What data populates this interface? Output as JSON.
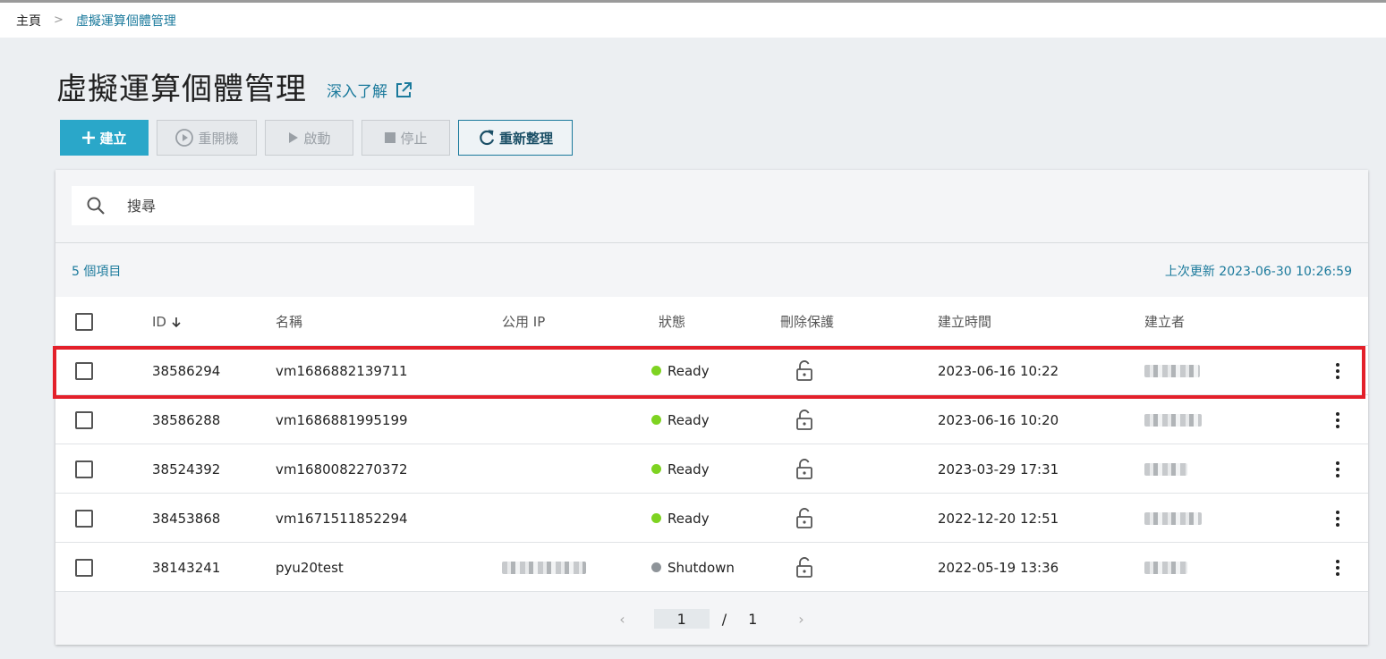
{
  "breadcrumb": {
    "home": "主頁",
    "separator": ">",
    "current": "虛擬運算個體管理"
  },
  "page": {
    "title": "虛擬運算個體管理",
    "learn_more": "深入了解"
  },
  "toolbar": {
    "create": "建立",
    "restart": "重開機",
    "start": "啟動",
    "stop": "停止",
    "refresh": "重新整理"
  },
  "search": {
    "placeholder": "搜尋"
  },
  "summary": {
    "count": "5 個項目",
    "last_updated": "上次更新 2023-06-30 10:26:59"
  },
  "table": {
    "headers": {
      "id": "ID",
      "name": "名稱",
      "public_ip": "公用 IP",
      "status": "狀態",
      "delete_protection": "刪除保護",
      "created_at": "建立時間",
      "creator": "建立者"
    },
    "rows": [
      {
        "id": "38586294",
        "name": "vm1686882139711",
        "status": "Ready",
        "created_at": "2023-06-16 10:22"
      },
      {
        "id": "38586288",
        "name": "vm1686881995199",
        "status": "Ready",
        "created_at": "2023-06-16 10:20"
      },
      {
        "id": "38524392",
        "name": "vm1680082270372",
        "status": "Ready",
        "created_at": "2023-03-29 17:31"
      },
      {
        "id": "38453868",
        "name": "vm1671511852294",
        "status": "Ready",
        "created_at": "2022-12-20 12:51"
      },
      {
        "id": "38143241",
        "name": "pyu20test",
        "status": "Shutdown",
        "created_at": "2022-05-19 13:36"
      }
    ]
  },
  "pagination": {
    "current": "1",
    "separator": "/",
    "total": "1"
  },
  "colors": {
    "accent": "#2aa7c9",
    "link": "#1b7a9c",
    "ready": "#7ed321",
    "shutdown": "#8e9499",
    "highlight": "#e3202a"
  }
}
